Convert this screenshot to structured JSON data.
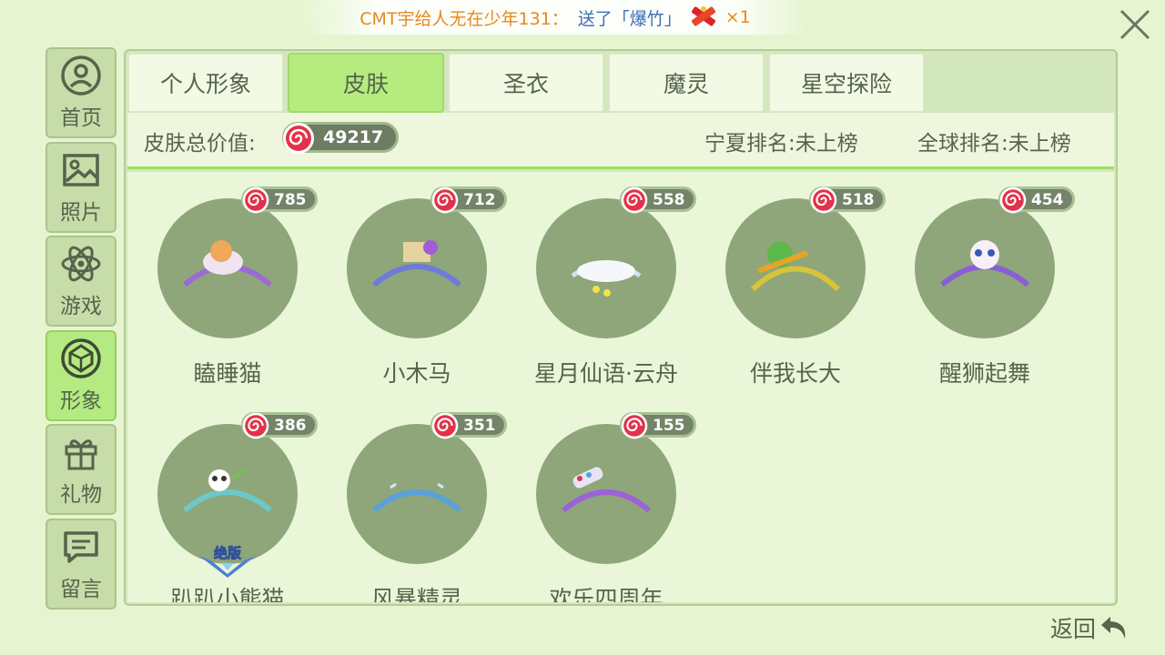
{
  "notice": {
    "sender": "CMT宇",
    "middle": "给人无在少年131：",
    "gift": "送了「爆竹」",
    "count": "×1"
  },
  "sidebar": {
    "items": [
      {
        "label": "首页",
        "icon": "person-circle-icon"
      },
      {
        "label": "照片",
        "icon": "photo-icon"
      },
      {
        "label": "游戏",
        "icon": "atom-icon"
      },
      {
        "label": "形象",
        "icon": "gem-icon"
      },
      {
        "label": "礼物",
        "icon": "gift-icon"
      },
      {
        "label": "留言",
        "icon": "message-icon"
      }
    ],
    "active_index": 3
  },
  "tabs": [
    {
      "label": "个人形象"
    },
    {
      "label": "皮肤"
    },
    {
      "label": "圣衣"
    },
    {
      "label": "魔灵"
    },
    {
      "label": "星空探险"
    }
  ],
  "active_tab": 1,
  "summary": {
    "total_label": "皮肤总价值:",
    "total_value": "49217",
    "local_rank": "宁夏排名:未上榜",
    "global_rank": "全球排名:未上榜"
  },
  "skins": [
    {
      "name": "瞌睡猫",
      "value": "785"
    },
    {
      "name": "小木马",
      "value": "712"
    },
    {
      "name": "星月仙语·云舟",
      "value": "558"
    },
    {
      "name": "伴我长大",
      "value": "518"
    },
    {
      "name": "醒狮起舞",
      "value": "454"
    },
    {
      "name": "趴趴小熊猫",
      "value": "386",
      "limited": "绝版"
    },
    {
      "name": "风暴精灵",
      "value": "351"
    },
    {
      "name": "欢乐四周年",
      "value": "155"
    }
  ],
  "back_label": "返回",
  "colors": {
    "background": "#e6f5cf",
    "active_tab": "#b6ec7f",
    "circle": "#8ea67a",
    "candy": "#e2324b"
  }
}
